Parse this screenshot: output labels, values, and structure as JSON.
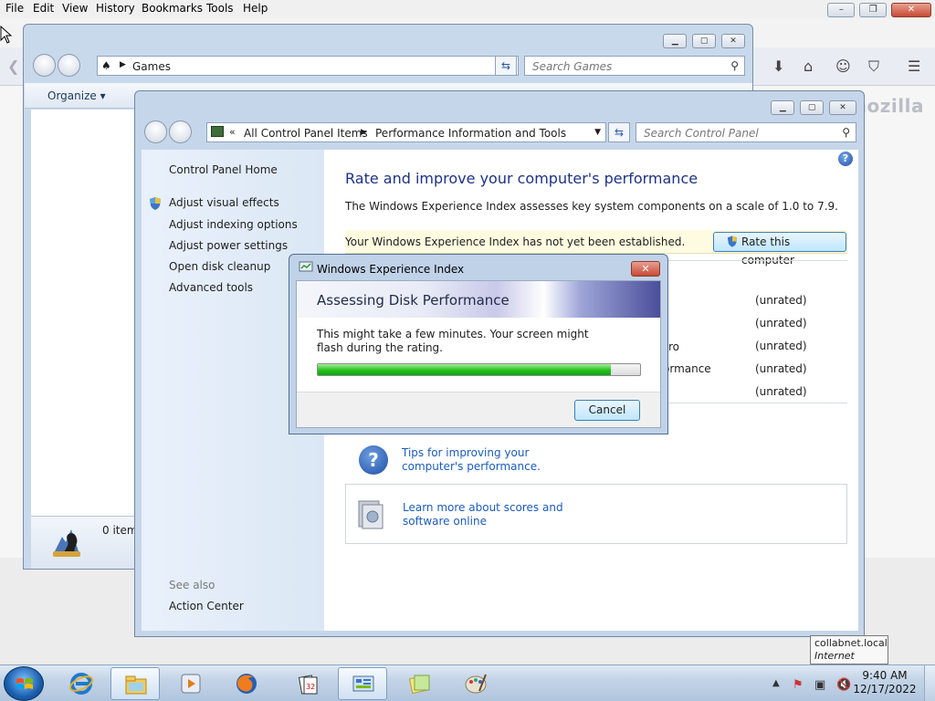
{
  "firefox": {
    "menu": [
      "File",
      "Edit",
      "View",
      "History",
      "Bookmarks",
      "Tools",
      "Help"
    ],
    "brand": "mozilla",
    "window_buttons": [
      "–",
      "❐",
      "✕"
    ]
  },
  "games_window": {
    "address": "Games",
    "search_placeholder": "Search Games",
    "organize": "Organize",
    "status_count": "0 item"
  },
  "control_panel": {
    "breadcrumb": [
      "All Control Panel Items",
      "Performance Information and Tools"
    ],
    "search_placeholder": "Search Control Panel",
    "sidebar": {
      "home": "Control Panel Home",
      "items": [
        "Adjust visual effects",
        "Adjust indexing options",
        "Adjust power settings",
        "Open disk cleanup",
        "Advanced tools"
      ],
      "see_also": "See also",
      "action_center": "Action Center"
    },
    "heading": "Rate and improve your computer's performance",
    "description": "The Windows Experience Index assesses key system components on a scale of 1.0 to 7.9.",
    "notice": "Your Windows Experience Index has not yet been established.",
    "rate_button": "Rate this computer",
    "partial_labels": [
      "ro",
      "ormance"
    ],
    "ratings": [
      "(unrated)",
      "(unrated)",
      "(unrated)",
      "(unrated)",
      "(unrated)"
    ],
    "tips_link": "Tips for improving your computer's performance.",
    "learn_link": "Learn more about scores and software online"
  },
  "dialog": {
    "title": "Windows Experience Index",
    "banner_heading": "Assessing Disk Performance",
    "message": "This might take a few minutes. Your screen might flash during the rating.",
    "progress": 0.91,
    "cancel": "Cancel",
    "close": "✕"
  },
  "tooltip": {
    "line1": "collabnet.local",
    "line2": "Internet access"
  },
  "taskbar": {
    "time": "9:40 AM",
    "date": "12/17/2022"
  }
}
